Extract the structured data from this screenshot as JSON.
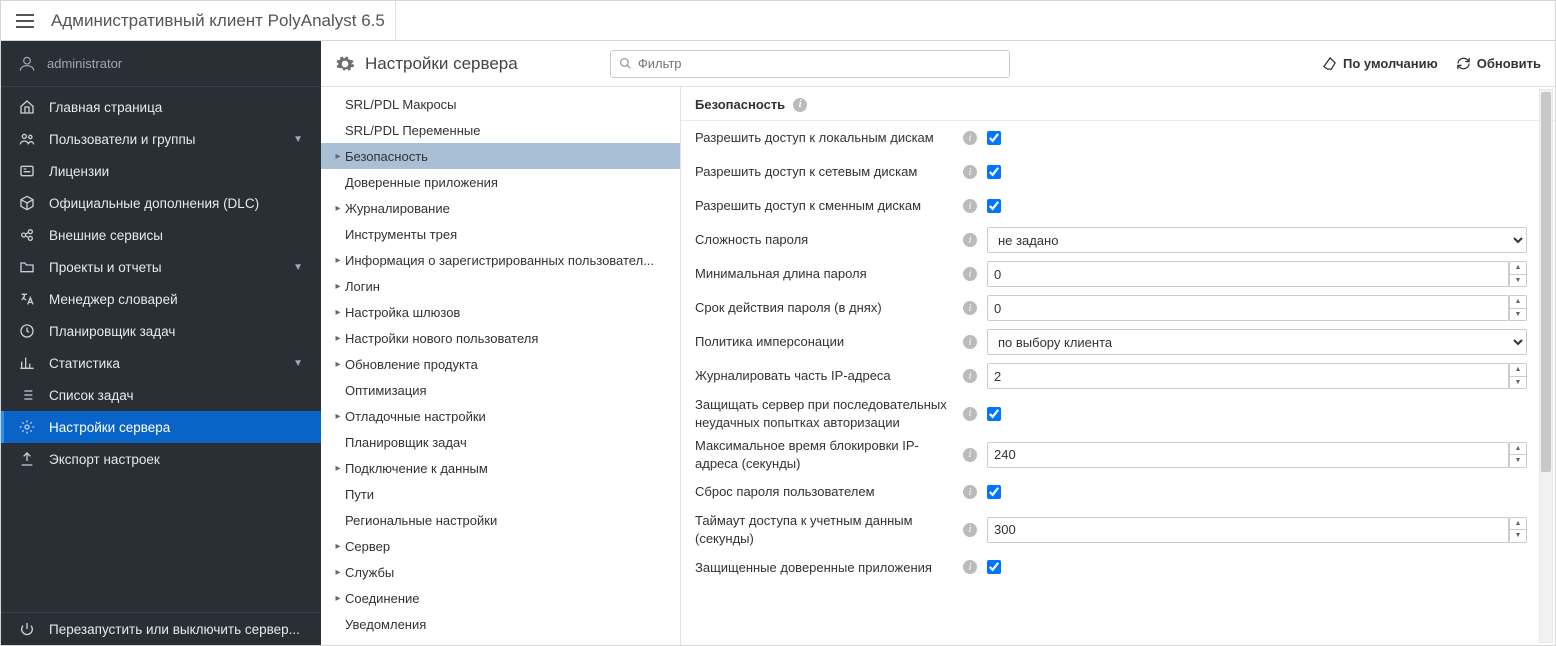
{
  "header": {
    "title": "Административный клиент PolyAnalyst 6.5"
  },
  "user": {
    "name": "administrator"
  },
  "sidebar": {
    "items": [
      {
        "icon": "home",
        "label": "Главная страница",
        "expandable": false
      },
      {
        "icon": "users",
        "label": "Пользователи и группы",
        "expandable": true
      },
      {
        "icon": "id",
        "label": "Лицензии",
        "expandable": false
      },
      {
        "icon": "package",
        "label": "Официальные дополнения (DLC)",
        "expandable": false
      },
      {
        "icon": "link",
        "label": "Внешние сервисы",
        "expandable": false
      },
      {
        "icon": "folder",
        "label": "Проекты и отчеты",
        "expandable": true
      },
      {
        "icon": "translate",
        "label": "Менеджер словарей",
        "expandable": false
      },
      {
        "icon": "clock",
        "label": "Планировщик задач",
        "expandable": false
      },
      {
        "icon": "chart",
        "label": "Статистика",
        "expandable": true
      },
      {
        "icon": "list",
        "label": "Список задач",
        "expandable": false
      },
      {
        "icon": "cogs",
        "label": "Настройки сервера",
        "expandable": false,
        "active": true
      },
      {
        "icon": "upload",
        "label": "Экспорт настроек",
        "expandable": false
      }
    ],
    "footer": {
      "icon": "power",
      "label": "Перезапустить или выключить сервер..."
    }
  },
  "content": {
    "title": "Настройки сервера",
    "filter_placeholder": "Фильтр",
    "btn_default": "По умолчанию",
    "btn_refresh": "Обновить"
  },
  "tree": {
    "items": [
      {
        "label": "SRL/PDL Макросы",
        "caret": false
      },
      {
        "label": "SRL/PDL Переменные",
        "caret": false
      },
      {
        "label": "Безопасность",
        "caret": true,
        "selected": true
      },
      {
        "label": "Доверенные приложения",
        "caret": false
      },
      {
        "label": "Журналирование",
        "caret": true
      },
      {
        "label": "Инструменты трея",
        "caret": false
      },
      {
        "label": "Информация о зарегистрированных пользовател...",
        "caret": true
      },
      {
        "label": "Логин",
        "caret": true
      },
      {
        "label": "Настройка шлюзов",
        "caret": true
      },
      {
        "label": "Настройки нового пользователя",
        "caret": true
      },
      {
        "label": "Обновление продукта",
        "caret": true
      },
      {
        "label": "Оптимизация",
        "caret": false
      },
      {
        "label": "Отладочные настройки",
        "caret": true
      },
      {
        "label": "Планировщик задач",
        "caret": false
      },
      {
        "label": "Подключение к данным",
        "caret": true
      },
      {
        "label": "Пути",
        "caret": false
      },
      {
        "label": "Региональные настройки",
        "caret": false
      },
      {
        "label": "Сервер",
        "caret": true
      },
      {
        "label": "Службы",
        "caret": true
      },
      {
        "label": "Соединение",
        "caret": true
      },
      {
        "label": "Уведомления",
        "caret": false
      }
    ]
  },
  "form": {
    "section_title": "Безопасность",
    "rows": [
      {
        "label": "Разрешить доступ к локальным дискам",
        "type": "checkbox",
        "value": true
      },
      {
        "label": "Разрешить доступ к сетевым дискам",
        "type": "checkbox",
        "value": true
      },
      {
        "label": "Разрешить доступ к сменным дискам",
        "type": "checkbox",
        "value": true
      },
      {
        "label": "Сложность пароля",
        "type": "select",
        "value": "не задано"
      },
      {
        "label": "Минимальная длина пароля",
        "type": "spinner",
        "value": "0"
      },
      {
        "label": "Срок действия пароля (в днях)",
        "type": "spinner",
        "value": "0"
      },
      {
        "label": "Политика имперсонации",
        "type": "select",
        "value": "по выбору клиента"
      },
      {
        "label": "Журналировать часть IP-адреса",
        "type": "spinner",
        "value": "2"
      },
      {
        "label": "Защищать сервер при последовательных неудачных попытках авторизации",
        "type": "checkbox",
        "value": true
      },
      {
        "label": "Максимальное время блокировки IP-адреса (секунды)",
        "type": "spinner",
        "value": "240"
      },
      {
        "label": "Сброс пароля пользователем",
        "type": "checkbox",
        "value": true
      },
      {
        "label": "Таймаут доступа к учетным данным (секунды)",
        "type": "spinner",
        "value": "300"
      },
      {
        "label": "Защищенные доверенные приложения",
        "type": "checkbox",
        "value": true
      }
    ]
  }
}
